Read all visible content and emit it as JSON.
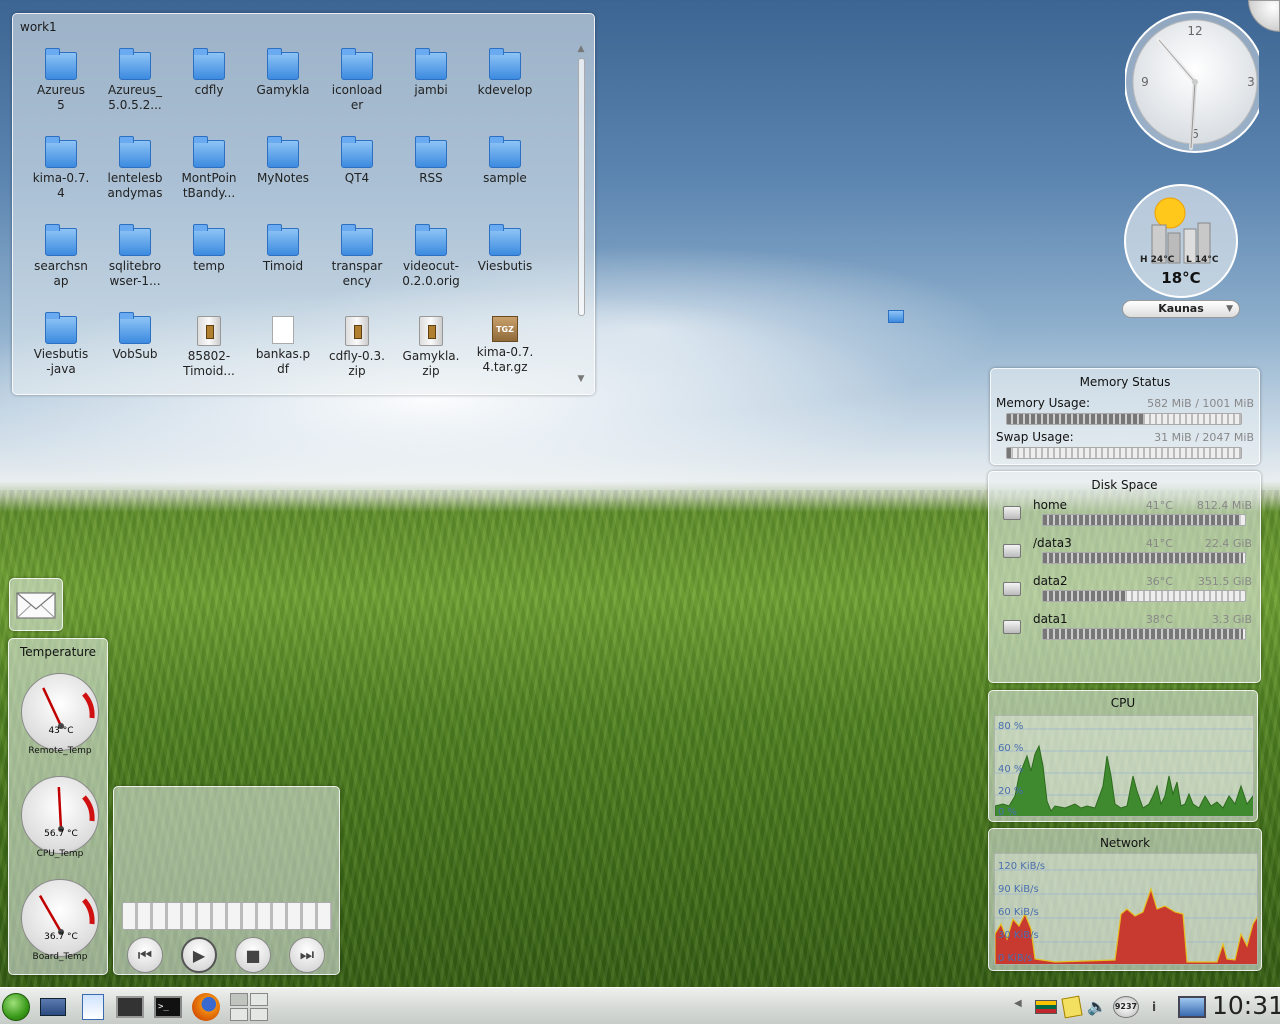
{
  "folderview": {
    "title": "work1",
    "items": [
      {
        "label": "Azureus\n5",
        "type": "folder"
      },
      {
        "label": "Azureus_\n5.0.5.2...",
        "type": "folder"
      },
      {
        "label": "cdfly",
        "type": "app-folder"
      },
      {
        "label": "Gamykla",
        "type": "folder"
      },
      {
        "label": "iconload\ner",
        "type": "folder"
      },
      {
        "label": "jambi",
        "type": "folder"
      },
      {
        "label": "kdevelop",
        "type": "folder"
      },
      {
        "label": "kima-0.7.\n4",
        "type": "folder"
      },
      {
        "label": "lentelesb\nandymas",
        "type": "folder"
      },
      {
        "label": "MontPoin\ntBandy...",
        "type": "folder"
      },
      {
        "label": "MyNotes",
        "type": "folder"
      },
      {
        "label": "QT4",
        "type": "folder"
      },
      {
        "label": "RSS",
        "type": "folder"
      },
      {
        "label": "sample",
        "type": "folder"
      },
      {
        "label": "searchsn\nap",
        "type": "folder"
      },
      {
        "label": "sqlitebro\nwser-1...",
        "type": "folder"
      },
      {
        "label": "temp",
        "type": "folder"
      },
      {
        "label": "Timoid",
        "type": "folder"
      },
      {
        "label": "transpar\nency",
        "type": "folder"
      },
      {
        "label": "videocut-\n0.2.0.orig",
        "type": "folder"
      },
      {
        "label": "Viesbutis",
        "type": "folder"
      },
      {
        "label": "Viesbutis\n-java",
        "type": "folder"
      },
      {
        "label": "VobSub",
        "type": "folder"
      },
      {
        "label": "85802-\nTimoid...",
        "type": "zip"
      },
      {
        "label": "bankas.p\ndf",
        "type": "doc"
      },
      {
        "label": "cdfly-0.3.\nzip",
        "type": "zip"
      },
      {
        "label": "Gamykla.\nzip",
        "type": "zip"
      },
      {
        "label": "kima-0.7.\n4.tar.gz",
        "type": "tgz"
      }
    ]
  },
  "clock": {
    "numbers": [
      "12",
      "3",
      "6",
      "9"
    ]
  },
  "weather": {
    "high": "H 24°C",
    "low": "L 14°C",
    "current": "18°C",
    "city": "Kaunas"
  },
  "memory": {
    "title": "Memory Status",
    "rows": [
      {
        "label": "Memory Usage:",
        "value": "582 MiB / 1001 MiB",
        "fraction": 0.58
      },
      {
        "label": "Swap Usage:",
        "value": "31 MiB / 2047 MiB",
        "fraction": 0.02
      }
    ]
  },
  "disk": {
    "title": "Disk Space",
    "rows": [
      {
        "label": "home",
        "temp": "41°C",
        "value": "812.4 MiB",
        "fraction": 0.98
      },
      {
        "label": "/data3",
        "temp": "41°C",
        "value": "22.4 GiB",
        "fraction": 0.99
      },
      {
        "label": "data2",
        "temp": "36°C",
        "value": "351.5 GiB",
        "fraction": 0.41
      },
      {
        "label": "data1",
        "temp": "38°C",
        "value": "3.3 GiB",
        "fraction": 0.99
      }
    ]
  },
  "cpu": {
    "title": "CPU",
    "ylabels": [
      "80 %",
      "60 %",
      "40 %",
      "20 %",
      "0 %"
    ]
  },
  "network": {
    "title": "Network",
    "ylabels": [
      "120 KiB/s",
      "90 KiB/s",
      "60 KiB/s",
      "30 KiB/s",
      "0 KiB/s"
    ]
  },
  "temperature": {
    "title": "Temperature",
    "gauges": [
      {
        "value": "43 °C",
        "name": "Remote_Temp"
      },
      {
        "value": "56.7 °C",
        "name": "CPU_Temp"
      },
      {
        "value": "36.7 °C",
        "name": "Board_Temp"
      }
    ]
  },
  "tray": {
    "badge": "9237",
    "time": "10:31"
  }
}
